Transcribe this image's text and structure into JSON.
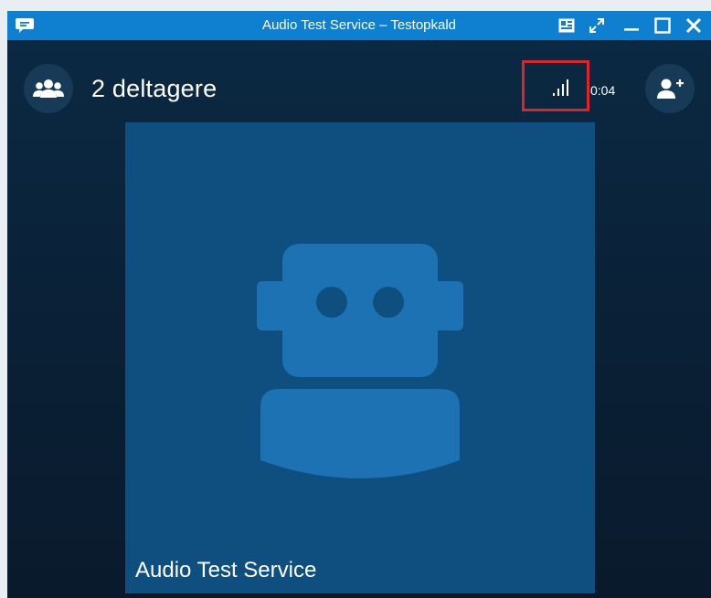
{
  "window": {
    "title": "Audio Test Service – Testopkald",
    "controls": [
      "compact-view-icon",
      "full-screen-icon",
      "minimize-icon",
      "maximize-icon",
      "close-icon"
    ]
  },
  "call_header": {
    "participants_count_label": "2 deltagere",
    "call_timer": "0:04",
    "signal_icon": "signal-strength-icon",
    "highlight_color": "#e0222a"
  },
  "video_tile": {
    "participant_name": "Audio Test Service",
    "avatar_icon": "bot-avatar-icon"
  },
  "colors": {
    "titlebar": "#0f7fd0",
    "tile": "#0e4f80",
    "avatar": "#1d72b3"
  }
}
